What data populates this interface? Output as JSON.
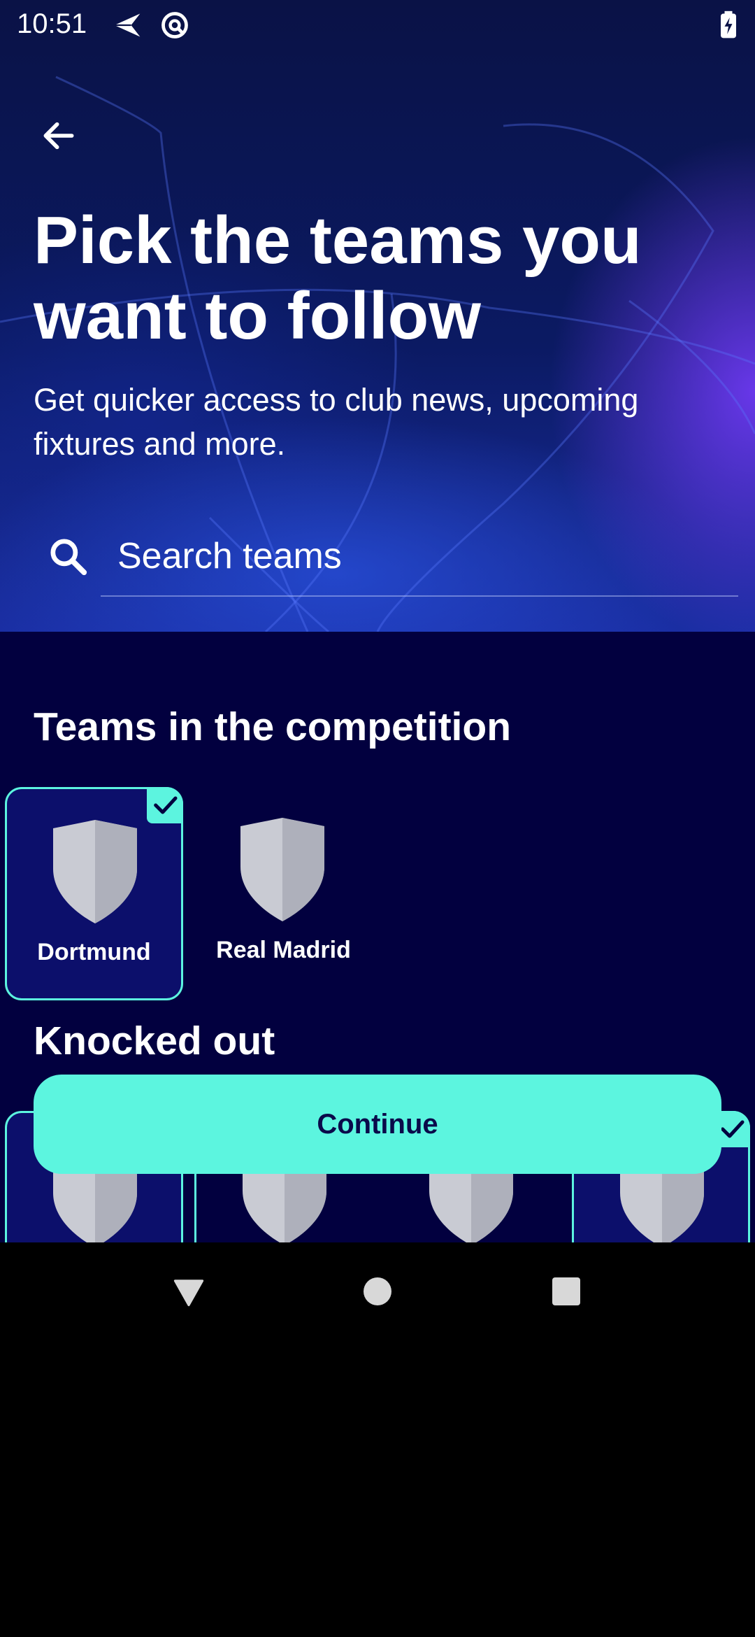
{
  "status_bar": {
    "time": "10:51",
    "icons": [
      "send-icon",
      "at-sign-icon",
      "battery-charging-icon"
    ]
  },
  "header": {
    "back_icon": "arrow-left-icon",
    "title": "Pick the teams you want to follow",
    "subtitle": "Get quicker access to club news, upcoming fixtures and more."
  },
  "search": {
    "icon": "search-icon",
    "placeholder": "Search teams",
    "value": ""
  },
  "sections": {
    "competition": {
      "title": "Teams in the competition",
      "teams": [
        {
          "name": "Dortmund",
          "selected": true
        },
        {
          "name": "Real Madrid",
          "selected": false
        }
      ]
    },
    "knocked_out": {
      "title": "Knocked out"
    }
  },
  "continue_button": {
    "label": "Continue"
  },
  "colors": {
    "background": "#02003f",
    "accent": "#5cf4df",
    "selected_card": "#0c0f6b"
  },
  "nav_bar": {
    "icons": [
      "back-triangle-icon",
      "home-circle-icon",
      "recents-square-icon"
    ]
  }
}
